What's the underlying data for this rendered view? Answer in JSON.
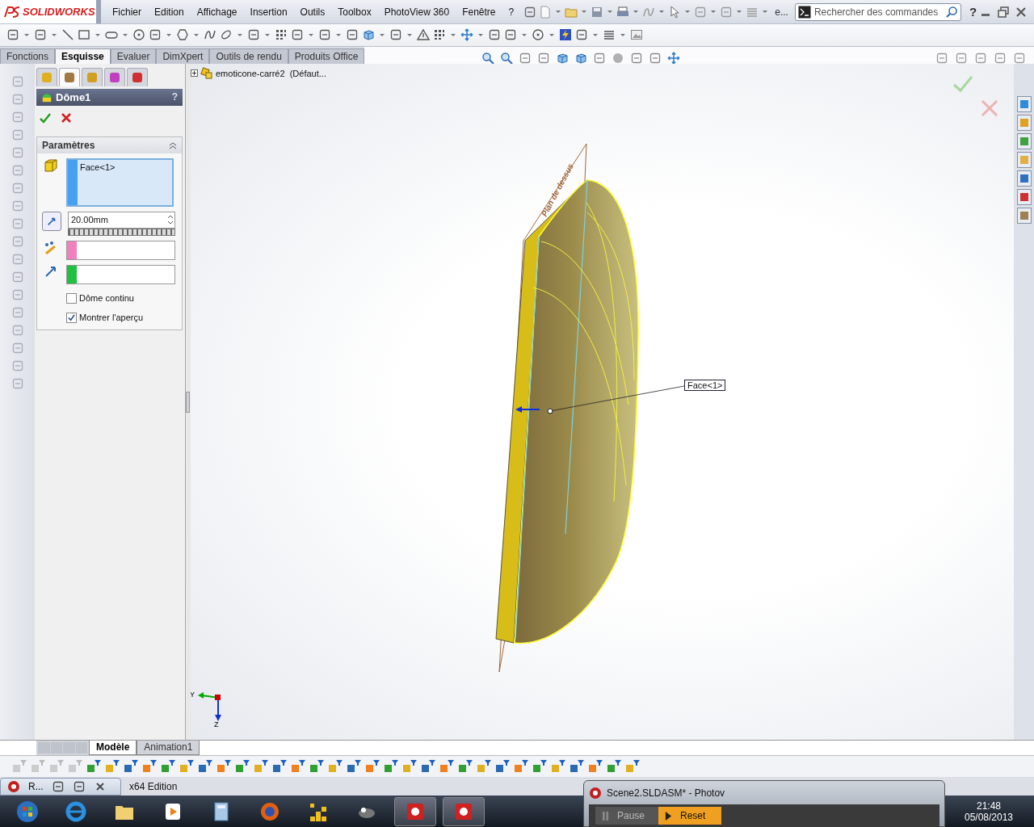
{
  "app": {
    "logo": "SOLIDWORKS"
  },
  "menu": [
    {
      "label": "Fichier"
    },
    {
      "label": "Edition"
    },
    {
      "label": "Affichage"
    },
    {
      "label": "Insertion"
    },
    {
      "label": "Outils"
    },
    {
      "label": "Toolbox"
    },
    {
      "label": "PhotoView 360"
    },
    {
      "label": "Fenêtre"
    },
    {
      "label": "?"
    }
  ],
  "quick_toolbar_overflow": "e...",
  "search": {
    "placeholder": "Rechercher des commandes"
  },
  "help": "?",
  "command_tabs": [
    {
      "label": "Fonctions",
      "selected": false
    },
    {
      "label": "Esquisse",
      "selected": true
    },
    {
      "label": "Evaluer",
      "selected": false
    },
    {
      "label": "DimXpert",
      "selected": false
    },
    {
      "label": "Outils de rendu",
      "selected": false
    },
    {
      "label": "Produits Office",
      "selected": false
    }
  ],
  "property_manager": {
    "panel_tabs": [
      {
        "selected": false
      },
      {
        "selected": true
      },
      {
        "selected": false
      },
      {
        "selected": false
      },
      {
        "selected": false
      }
    ],
    "title": "Dôme1",
    "help": "?",
    "section": {
      "title": "Paramètres",
      "faces": [
        "Face<1>"
      ],
      "distance": "20.00mm",
      "checkboxes": [
        {
          "label": "Dôme continu",
          "checked": false
        },
        {
          "label": "Montrer l'aperçu",
          "checked": true
        }
      ]
    }
  },
  "viewport": {
    "tree_root": "emoticone-carré2  (Défaut...",
    "plane_label": "Plan de dessus",
    "callout": "Face<1>",
    "triad": {
      "y": "Y",
      "z": "Z"
    }
  },
  "bottom_tabs": [
    {
      "label": "Modèle",
      "selected": true
    },
    {
      "label": "Animation1",
      "selected": false
    }
  ],
  "minimized_window": {
    "title": "R..."
  },
  "background_window_title": "x64 Edition",
  "photoview": {
    "title": "Scene2.SLDASM* - Photov",
    "buttons": [
      {
        "label": "Pause",
        "selected": false
      },
      {
        "label": "Reset",
        "selected": true
      }
    ]
  },
  "clock": {
    "time": "21:48",
    "date": "05/08/2013"
  }
}
